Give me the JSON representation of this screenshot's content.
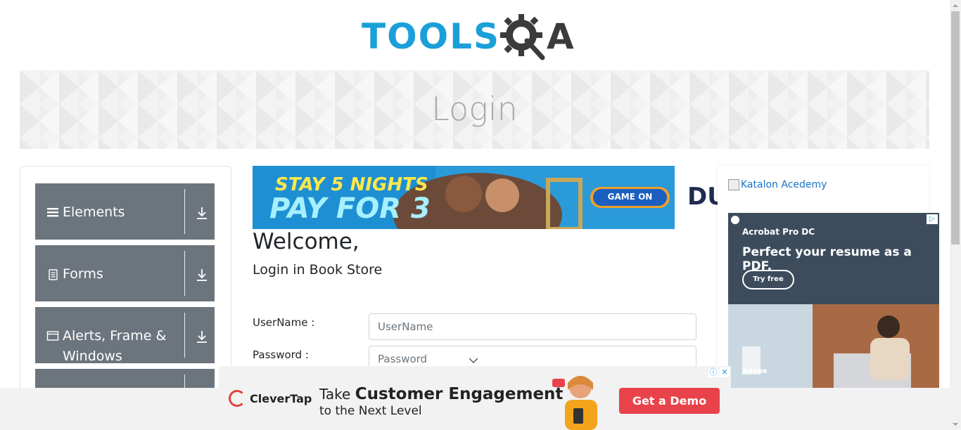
{
  "header": {
    "logo_text": "TOOLS",
    "logo_suffix": "A"
  },
  "banner": {
    "title": "Login"
  },
  "sidebar": {
    "groups": [
      {
        "label": "Elements",
        "icon": "menu-icon"
      },
      {
        "label": "Forms",
        "icon": "document-icon"
      },
      {
        "label": "Alerts, Frame & Windows",
        "icon": "window-icon"
      }
    ]
  },
  "ads": {
    "top": {
      "line1": "STAY 5 NIGHTS",
      "line2": "PAY FOR 3",
      "cta": "GAME ON",
      "brand": "DU"
    },
    "side": {
      "katalon_alt": "Katalon Acedemy",
      "product": "Acrobat Pro DC",
      "headline": "Perfect your resume as a PDF.",
      "cta": "Try free",
      "brand": "Adobe"
    },
    "bottom": {
      "brand": "CleverTap",
      "take": "Take",
      "headline": "Customer Engagement",
      "subline": "to the Next Level",
      "cta": "Get a Demo"
    }
  },
  "main": {
    "welcome": "Welcome,",
    "subtitle": "Login in Book Store",
    "username_label": "UserName :",
    "username_placeholder": "UserName",
    "password_label": "Password :",
    "password_placeholder": "Password"
  },
  "colors": {
    "logo_blue": "#1b9fd8",
    "menu_gray": "#6c757d",
    "cta_red": "#e8434a"
  }
}
